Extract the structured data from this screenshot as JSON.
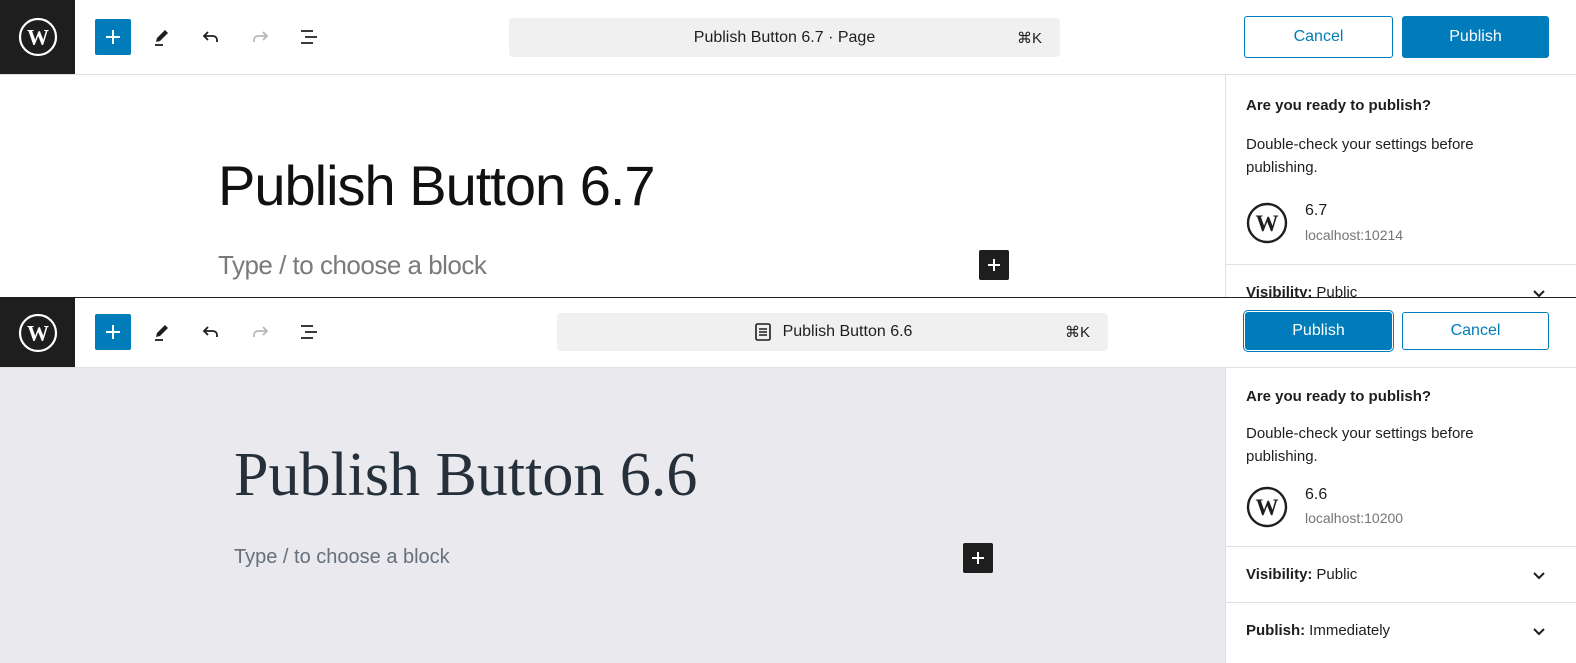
{
  "panel_67": {
    "command_bar": {
      "title": "Publish Button 6.7 · Page",
      "shortcut": "⌘K"
    },
    "buttons": {
      "cancel": "Cancel",
      "publish": "Publish"
    },
    "editor": {
      "title": "Publish Button 6.7",
      "placeholder": "Type / to choose a block"
    },
    "sidebar": {
      "heading": "Are you ready to publish?",
      "description": "Double-check your settings before publishing.",
      "site_name": "6.7",
      "site_url": "localhost:10214",
      "visibility_label": "Visibility:",
      "visibility_value": "Public"
    }
  },
  "panel_66": {
    "command_bar": {
      "title": "Publish Button 6.6",
      "shortcut": "⌘K"
    },
    "buttons": {
      "publish": "Publish",
      "cancel": "Cancel"
    },
    "editor": {
      "title": "Publish Button 6.6",
      "placeholder": "Type / to choose a block"
    },
    "sidebar": {
      "heading": "Are you ready to publish?",
      "description": "Double-check your settings before publishing.",
      "site_name": "6.6",
      "site_url": "localhost:10200",
      "visibility_label": "Visibility:",
      "visibility_value": "Public",
      "publish_label": "Publish:",
      "publish_value": "Immediately"
    }
  },
  "toolbar_icons": [
    "wordpress-logo-icon",
    "plus-icon",
    "pencil-icon",
    "undo-icon",
    "redo-icon",
    "list-view-icon"
  ],
  "colors": {
    "accent": "#007cba",
    "logo_bg": "#1e1e1e",
    "canvas_66_bg": "#e9e9ee",
    "command_bar_bg": "#f0f0f0"
  }
}
